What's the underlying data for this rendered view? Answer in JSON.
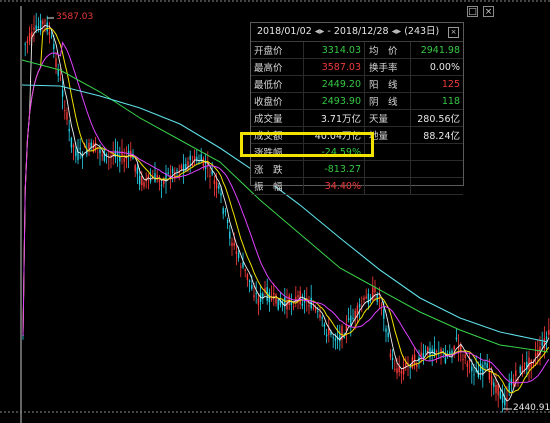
{
  "chart_data": {
    "type": "candlestick",
    "high_label": "3587.03",
    "low_label": "2440.91",
    "colors": {
      "up": "#ff3c3c",
      "down": "#23d2e6",
      "ma5": "#f0f0f0",
      "ma10": "#f2e200",
      "ma20": "#e040ff",
      "ma60": "#39d24a",
      "ma120": "#5fe0e8"
    }
  },
  "panel": {
    "start_date": "2018/01/02",
    "end_date": "2018/12/28",
    "arrow_icon": "◂▸",
    "day_count": "(243日)",
    "close_icon": "×",
    "rows": [
      {
        "k": "开盘价",
        "v": "3314.03",
        "vc": "g",
        "k2": "均　价",
        "v2": "2941.98",
        "v2c": "g"
      },
      {
        "k": "最高价",
        "v": "3587.03",
        "vc": "r",
        "k2": "换手率",
        "v2": "0.00%",
        "v2c": "w"
      },
      {
        "k": "最低价",
        "v": "2449.20",
        "vc": "g",
        "k2": "阳　线",
        "v2": "125",
        "v2c": "r"
      },
      {
        "k": "收盘价",
        "v": "2493.90",
        "vc": "g",
        "k2": "阴　线",
        "v2": "118",
        "v2c": "g"
      },
      {
        "k": "成交量",
        "v": "3.71万亿",
        "vc": "w",
        "k2": "天量",
        "v2": "280.56亿",
        "v2c": "w"
      },
      {
        "k": "成交额",
        "v": "40.04万亿",
        "vc": "w",
        "k2": "地量",
        "v2": "88.24亿",
        "v2c": "w"
      },
      {
        "k": "涨跌幅",
        "v": "-24.59%",
        "vc": "g",
        "k2": "",
        "v2": "",
        "v2c": "w"
      },
      {
        "k": "涨　跌",
        "v": "-813.27",
        "vc": "g",
        "k2": "",
        "v2": "",
        "v2c": "w"
      },
      {
        "k": "振　幅",
        "v": "34.40%",
        "vc": "r",
        "k2": "",
        "v2": "",
        "v2c": "w"
      }
    ]
  },
  "window_buttons": {
    "maximize": "□",
    "close": "×"
  }
}
